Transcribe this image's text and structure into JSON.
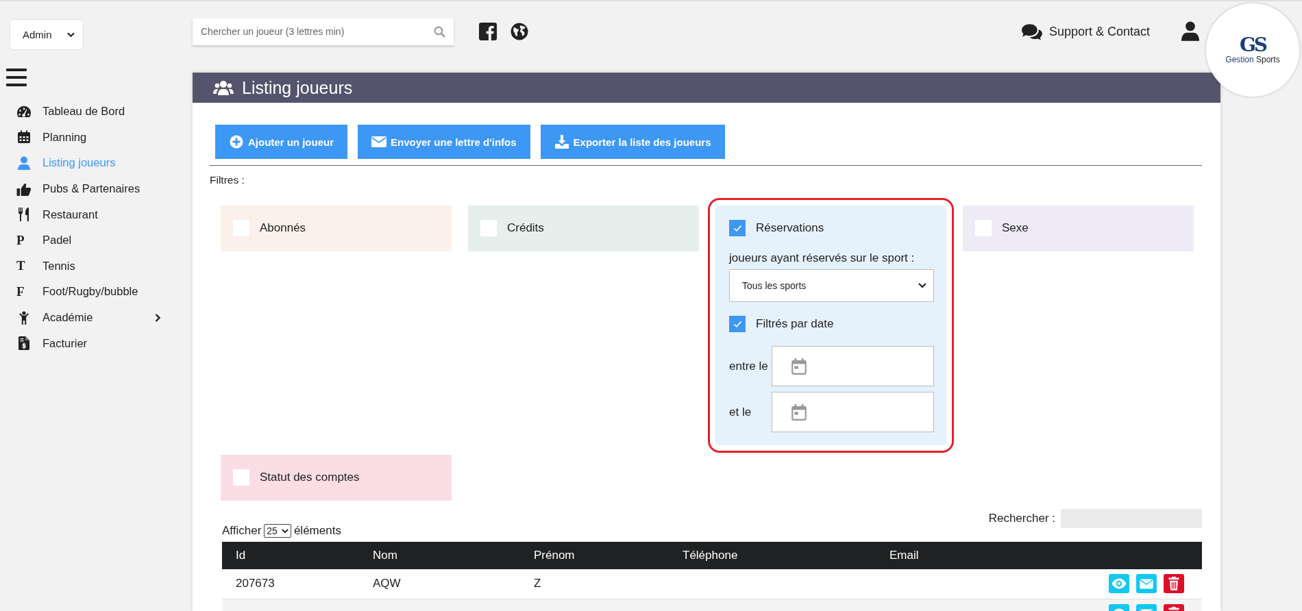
{
  "role_select": {
    "value": "Admin"
  },
  "search": {
    "placeholder": "Chercher un joueur (3 lettres min)"
  },
  "support_link": {
    "label": "Support & Contact"
  },
  "logo": {
    "mark": "GS",
    "name_1": "Gestion",
    "name_2": "Sports"
  },
  "sidebar": {
    "items": [
      {
        "label": "Tableau de Bord",
        "selected": false
      },
      {
        "label": "Planning",
        "selected": false
      },
      {
        "label": "Listing joueurs",
        "selected": true
      },
      {
        "label": "Pubs & Partenaires",
        "selected": false
      },
      {
        "label": "Restaurant",
        "selected": false
      },
      {
        "label": "Padel",
        "letter": "P",
        "selected": false
      },
      {
        "label": "Tennis",
        "letter": "T",
        "selected": false
      },
      {
        "label": "Foot/Rugby/bubble",
        "letter": "F",
        "selected": false
      },
      {
        "label": "Académie",
        "selected": false,
        "has_submenu": true
      },
      {
        "label": "Facturier",
        "selected": false
      }
    ]
  },
  "page_title": "Listing joueurs",
  "actions": [
    {
      "label": "Ajouter un joueur"
    },
    {
      "label": "Envoyer une lettre d'infos"
    },
    {
      "label": "Exporter la liste des joueurs"
    }
  ],
  "filters_label": "Filtres :",
  "filters": [
    {
      "label": "Abonnés",
      "checked": false,
      "color": "#fbf0ea"
    },
    {
      "label": "Crédits",
      "checked": false,
      "color": "#e6efec"
    },
    {
      "label": "Réservations",
      "checked": true,
      "color": "#e5f1fb",
      "highlighted": true,
      "sport_label": "joueurs ayant réservés sur le sport :",
      "sport_select": "Tous les sports",
      "date_filter": {
        "label": "Filtrés par date",
        "checked": true
      },
      "date_from_label": "entre le",
      "date_to_label": "et le"
    },
    {
      "label": "Sexe",
      "checked": false,
      "color": "#efebf6"
    },
    {
      "label": "Statut des comptes",
      "checked": false,
      "color": "#fbdde5"
    }
  ],
  "table": {
    "length_prefix": "Afficher",
    "length_value": "25",
    "length_suffix": "éléments",
    "search_label": "Rechercher :",
    "columns": [
      "Id",
      "Nom",
      "Prénom",
      "Téléphone",
      "Email"
    ],
    "rows": [
      {
        "cells": [
          "207673",
          "AQW",
          "Z",
          "",
          ""
        ]
      },
      {
        "cells": [
          "",
          "",
          "",
          "",
          ""
        ]
      }
    ]
  }
}
